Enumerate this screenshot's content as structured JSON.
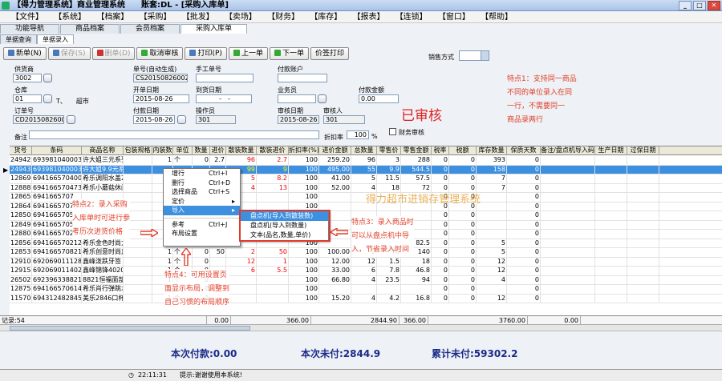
{
  "window": {
    "title": "【得力管理系统】商业管理系统　　账套:DL - [采购入库单]"
  },
  "menu": [
    "【文件】",
    "【系统】",
    "【档案】",
    "【采购】",
    "【批发】",
    "【卖场】",
    "【财务】",
    "【库存】",
    "【报表】",
    "【连锁】",
    "【窗口】",
    "【帮助】"
  ],
  "tabs": [
    "功能导航",
    "商品档案",
    "会员档案",
    "采购入库单"
  ],
  "subtabs": [
    "单据查询",
    "单据录入"
  ],
  "toolbar": {
    "new": "新单(N)",
    "save": "保存(S)",
    "delete": "删单(D)",
    "cancel_review": "取消审核",
    "print": "打印(P)",
    "prev": "上一单",
    "next": "下一单",
    "price_print": "价签打印"
  },
  "form": {
    "sales_mode_label": "销售方式",
    "supplier_label": "供货商",
    "supplier_value": "3002",
    "order_no_label": "单号(自动生成)",
    "order_no_value": "CS20150826002",
    "manual_no_label": "手工单号",
    "pay_account_label": "付款账户",
    "warehouse_label": "仓库",
    "warehouse_code": "01",
    "warehouse_name": "T、　　超市",
    "open_date_label": "开单日期",
    "open_date_value": "2015-08-26",
    "arrival_date_label": "到货日期",
    "arrival_date_value": "-　-",
    "salesman_label": "业务员",
    "pay_amount_label": "付款金额",
    "pay_amount_value": "0.00",
    "order_label": "订单号",
    "order_value": "CD20150826002",
    "pay_date_label": "付款日期",
    "pay_date_value": "2015-08-26",
    "operator_label": "操作员",
    "operator_value": "301",
    "review_date_label": "审核日期",
    "review_date_value": "2015-08-26",
    "reviewer_label": "审核人",
    "reviewer_value": "301",
    "discount_label": "折扣率",
    "discount_value": "100",
    "discount_unit": "%",
    "finance_review_label": "财务审核",
    "remark_label": "备注"
  },
  "stamp": "已审核",
  "notes": {
    "n1": [
      "特点1：支持同一商品",
      "不同的单位录入在同",
      "一行，不需要同一",
      "商品录两行"
    ],
    "n2": [
      "特点2：录入采购",
      "入库单时可进行参",
      "考历次进货价格"
    ],
    "n3": [
      "特点3：录入商品时",
      "可以从盘点机中导",
      "入，节省录入时间"
    ],
    "n4": [
      "特点4：可用设置页",
      "面显示布局，调整到",
      "自己习惯的布局顺序"
    ]
  },
  "watermark": "得力超市进销存管理系统",
  "grid": {
    "headers": [
      "货号",
      "条码",
      "商品名称",
      "包装规格",
      "内装数",
      "单位",
      "数量",
      "进价",
      "散装数量",
      "散装进价",
      "折扣率(%)",
      "进价金额",
      "总数量",
      "零售价",
      "零售金额",
      "税率",
      "税额",
      "库存数量",
      "保质天数",
      "备注/盘点机导入码",
      "生产日期",
      "过保日期"
    ],
    "rows": [
      [
        "24942",
        "6939810400035",
        "许大姐三元系列",
        "",
        "1",
        "个",
        "0",
        "2.7",
        "96",
        "2.7",
        "100",
        "259.20",
        "96",
        "3",
        "288",
        "0",
        "0",
        "393",
        "0",
        "",
        "",
        ""
      ],
      [
        "24943",
        "6939810400035",
        "许大姐9.9元系列",
        "",
        "",
        "",
        "",
        "",
        "99",
        "9",
        "100",
        "495.00",
        "55",
        "9.9",
        "544.5",
        "0",
        "0",
        "158",
        "0",
        "",
        "",
        ""
      ],
      [
        "12869",
        "6941665704008",
        "希乐调阳水盖230ml",
        "",
        "",
        "",
        "",
        "",
        "5",
        "8.2",
        "100",
        "41.00",
        "5",
        "11.5",
        "57.5",
        "0",
        "0",
        "7",
        "0",
        "",
        "",
        ""
      ],
      [
        "12888",
        "6941665704732",
        "希乐小蘑菇休闲杯",
        "",
        "",
        "",
        "",
        "",
        "4",
        "13",
        "100",
        "52.00",
        "4",
        "18",
        "72",
        "0",
        "0",
        "7",
        "0",
        "",
        "",
        ""
      ],
      [
        "12865",
        "6941665707",
        "",
        "",
        "",
        "",
        "",
        "",
        "",
        "",
        "100",
        "",
        "",
        "",
        "",
        "0",
        "0",
        "",
        "0",
        "",
        "",
        ""
      ],
      [
        "12864",
        "6941665707",
        "",
        "",
        "",
        "",
        "",
        "",
        "",
        "",
        "100",
        "",
        "",
        "",
        "",
        "0",
        "0",
        "",
        "0",
        "",
        "",
        ""
      ],
      [
        "12850",
        "6941665705",
        "",
        "",
        "",
        "",
        "",
        "",
        "",
        "",
        "100",
        "",
        "",
        "",
        "",
        "0",
        "0",
        "",
        "0",
        "",
        "",
        ""
      ],
      [
        "12849",
        "6941665705",
        "",
        "",
        "",
        "",
        "",
        "",
        "",
        "",
        "100",
        "",
        "",
        "",
        "",
        "0",
        "0",
        "",
        "0",
        "",
        "",
        ""
      ],
      [
        "12880",
        "6941665702",
        "",
        "",
        "",
        "",
        "",
        "",
        "",
        "",
        "100",
        "",
        "",
        "",
        "",
        "0",
        "0",
        "",
        "0",
        "",
        "",
        ""
      ],
      [
        "12856",
        "6941665702127",
        "希乐金色时尚太空",
        "",
        "",
        "",
        "",
        "",
        "",
        "",
        "100",
        "",
        "",
        "",
        "82.5",
        "0",
        "0",
        "5",
        "0",
        "",
        "",
        ""
      ],
      [
        "12853",
        "6941665708211",
        "希乐创意时尚真空",
        "",
        "1",
        "个",
        "0",
        "50",
        "2",
        "50",
        "100",
        "100.00",
        "2",
        "70",
        "140",
        "0",
        "0",
        "5",
        "0",
        "",
        "",
        ""
      ],
      [
        "12910",
        "6920690111283",
        "鑫峰泼跌牙签",
        "",
        "1",
        "个",
        "0",
        "",
        "12",
        "1",
        "100",
        "12.00",
        "12",
        "1.5",
        "18",
        "0",
        "0",
        "12",
        "0",
        "",
        "",
        ""
      ],
      [
        "12915",
        "6920690114020",
        "鑫峰锦锋4020",
        "",
        "1",
        "个",
        "0",
        "",
        "6",
        "5.5",
        "100",
        "33.00",
        "6",
        "7.8",
        "46.8",
        "0",
        "0",
        "12",
        "0",
        "",
        "",
        ""
      ],
      [
        "26502",
        "6923963388210",
        "8821恒福面部指制",
        "",
        "1",
        "个",
        "0",
        "",
        "",
        "",
        "100",
        "66.80",
        "4",
        "23.5",
        "94",
        "0",
        "0",
        "4",
        "0",
        "",
        "",
        ""
      ],
      [
        "12875",
        "6941665706149",
        "希乐肖行弹跳水瓶",
        "",
        "1",
        "个",
        "0",
        "",
        "",
        "",
        "100",
        "",
        "",
        "",
        "",
        "0",
        "0",
        "",
        "0",
        "",
        "",
        ""
      ],
      [
        "11570",
        "6943124828451",
        "美乐2846口杯",
        "",
        "1",
        "个",
        "0",
        "",
        "",
        "",
        "100",
        "15.20",
        "4",
        "4.2",
        "16.8",
        "0",
        "0",
        "12",
        "0",
        "",
        "",
        ""
      ]
    ]
  },
  "summary": {
    "label": "记录:54",
    "qty": "0.00",
    "bulk": "366.00",
    "amount": "2844.90",
    "total_qty": "366.00",
    "retail_amount": "3760.00",
    "stock": "0.00"
  },
  "context_menu": [
    {
      "label": "增行",
      "shortcut": "Ctrl+I"
    },
    {
      "label": "删行",
      "shortcut": "Ctrl+D"
    },
    {
      "label": "选择商品",
      "shortcut": "Ctrl+S"
    },
    {
      "label": "定价",
      "shortcut": "▸"
    },
    {
      "label": "导入",
      "shortcut": "▸"
    },
    {
      "label": "参考",
      "shortcut": "Ctrl+J"
    },
    {
      "label": "布局设置",
      "shortcut": ""
    }
  ],
  "submenu": [
    "盘点机(导入到散装数)",
    "盘点机(导入到数量)",
    "文本(品名,数量,单价)"
  ],
  "totals": {
    "paid": "本次付款:0.00",
    "unpaid": "本次未付:2844.9",
    "acc_unpaid": "累计未付:59302.2"
  },
  "status": {
    "time": "22:11:31",
    "tip": "提示:谢谢使用本系统!"
  }
}
